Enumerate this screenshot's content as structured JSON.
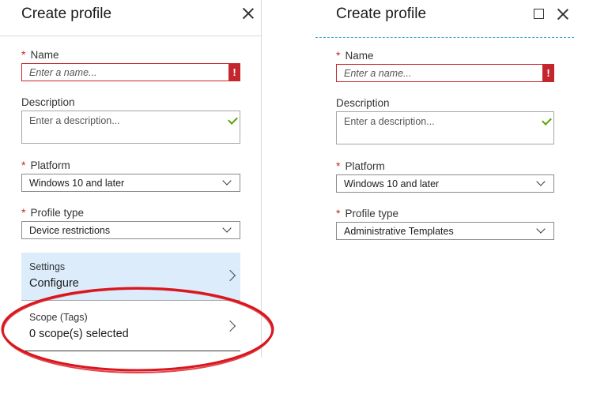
{
  "left": {
    "title": "Create profile",
    "name_label": "Name",
    "name_placeholder": "Enter a name...",
    "name_error": "!",
    "description_label": "Description",
    "description_placeholder": "Enter a description...",
    "platform_label": "Platform",
    "platform_value": "Windows 10 and later",
    "profile_type_label": "Profile type",
    "profile_type_value": "Device restrictions",
    "settings": {
      "label": "Settings",
      "value": "Configure"
    },
    "scope": {
      "label": "Scope (Tags)",
      "value": "0 scope(s) selected"
    }
  },
  "right": {
    "title": "Create profile",
    "name_label": "Name",
    "name_placeholder": "Enter a name...",
    "name_error": "!",
    "description_label": "Description",
    "description_placeholder": "Enter a description...",
    "platform_label": "Platform",
    "platform_value": "Windows 10 and later",
    "profile_type_label": "Profile type",
    "profile_type_value": "Administrative Templates"
  },
  "required_marker": "*",
  "colors": {
    "error": "#c4262e",
    "valid": "#57a300",
    "selected_item_bg": "#dcecfa",
    "annotation": "#d9161e",
    "accent_line": "#3fa9d8"
  }
}
